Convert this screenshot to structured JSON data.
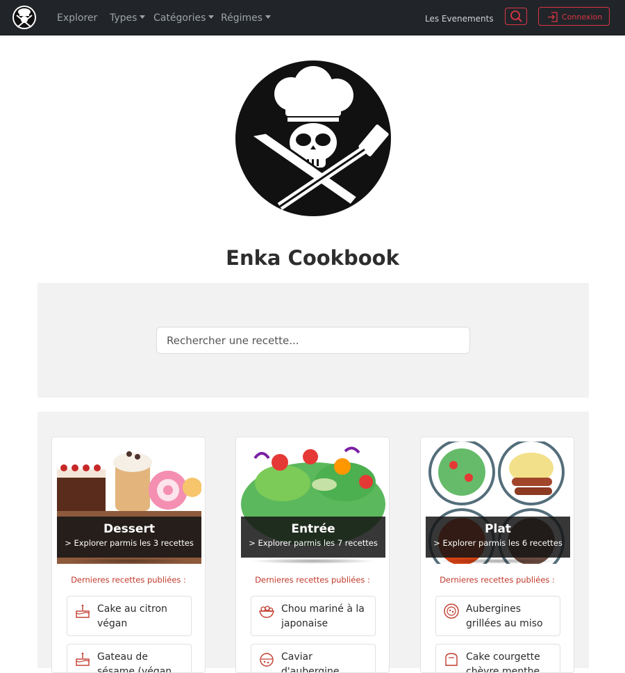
{
  "nav": {
    "logo_icon": "chef-skull-logo-icon",
    "explorer": "Explorer",
    "types": "Types",
    "categories": "Catégories",
    "regimes": "Régimes",
    "events": "Les Evenements",
    "search_icon": "search-icon",
    "login_icon": "login-icon",
    "login": "Connexion"
  },
  "colors": {
    "navbar": "#212529",
    "accent": "#dc3545",
    "panel": "#f2f2f2"
  },
  "hero": {
    "logo_icon": "chef-skull-logo-icon",
    "title": "Enka Cookbook"
  },
  "search": {
    "placeholder": "Rechercher une recette..."
  },
  "categories": [
    {
      "title": "Dessert",
      "subtitle": "> Explorer parmis les 3 recettes",
      "latest_label": "Dernieres recettes publiées :",
      "recipes": [
        {
          "name": "Cake au citron végan",
          "icon": "cake-icon"
        },
        {
          "name": "Gateau de sésame (végan et...",
          "icon": "cake-icon"
        }
      ]
    },
    {
      "title": "Entrée",
      "subtitle": "> Explorer parmis les 7 recettes",
      "latest_label": "Dernieres recettes publiées :",
      "recipes": [
        {
          "name": "Chou mariné à la japonaise",
          "icon": "salad-bowl-icon"
        },
        {
          "name": "Caviar d'aubergine",
          "icon": "bowl-icon"
        }
      ]
    },
    {
      "title": "Plat",
      "subtitle": "> Explorer parmis les 6 recettes",
      "latest_label": "Dernieres recettes publiées :",
      "recipes": [
        {
          "name": "Aubergines grillées au miso",
          "icon": "dish-icon"
        },
        {
          "name": "Cake courgette chèvre menthe",
          "icon": "bread-icon"
        }
      ]
    }
  ]
}
